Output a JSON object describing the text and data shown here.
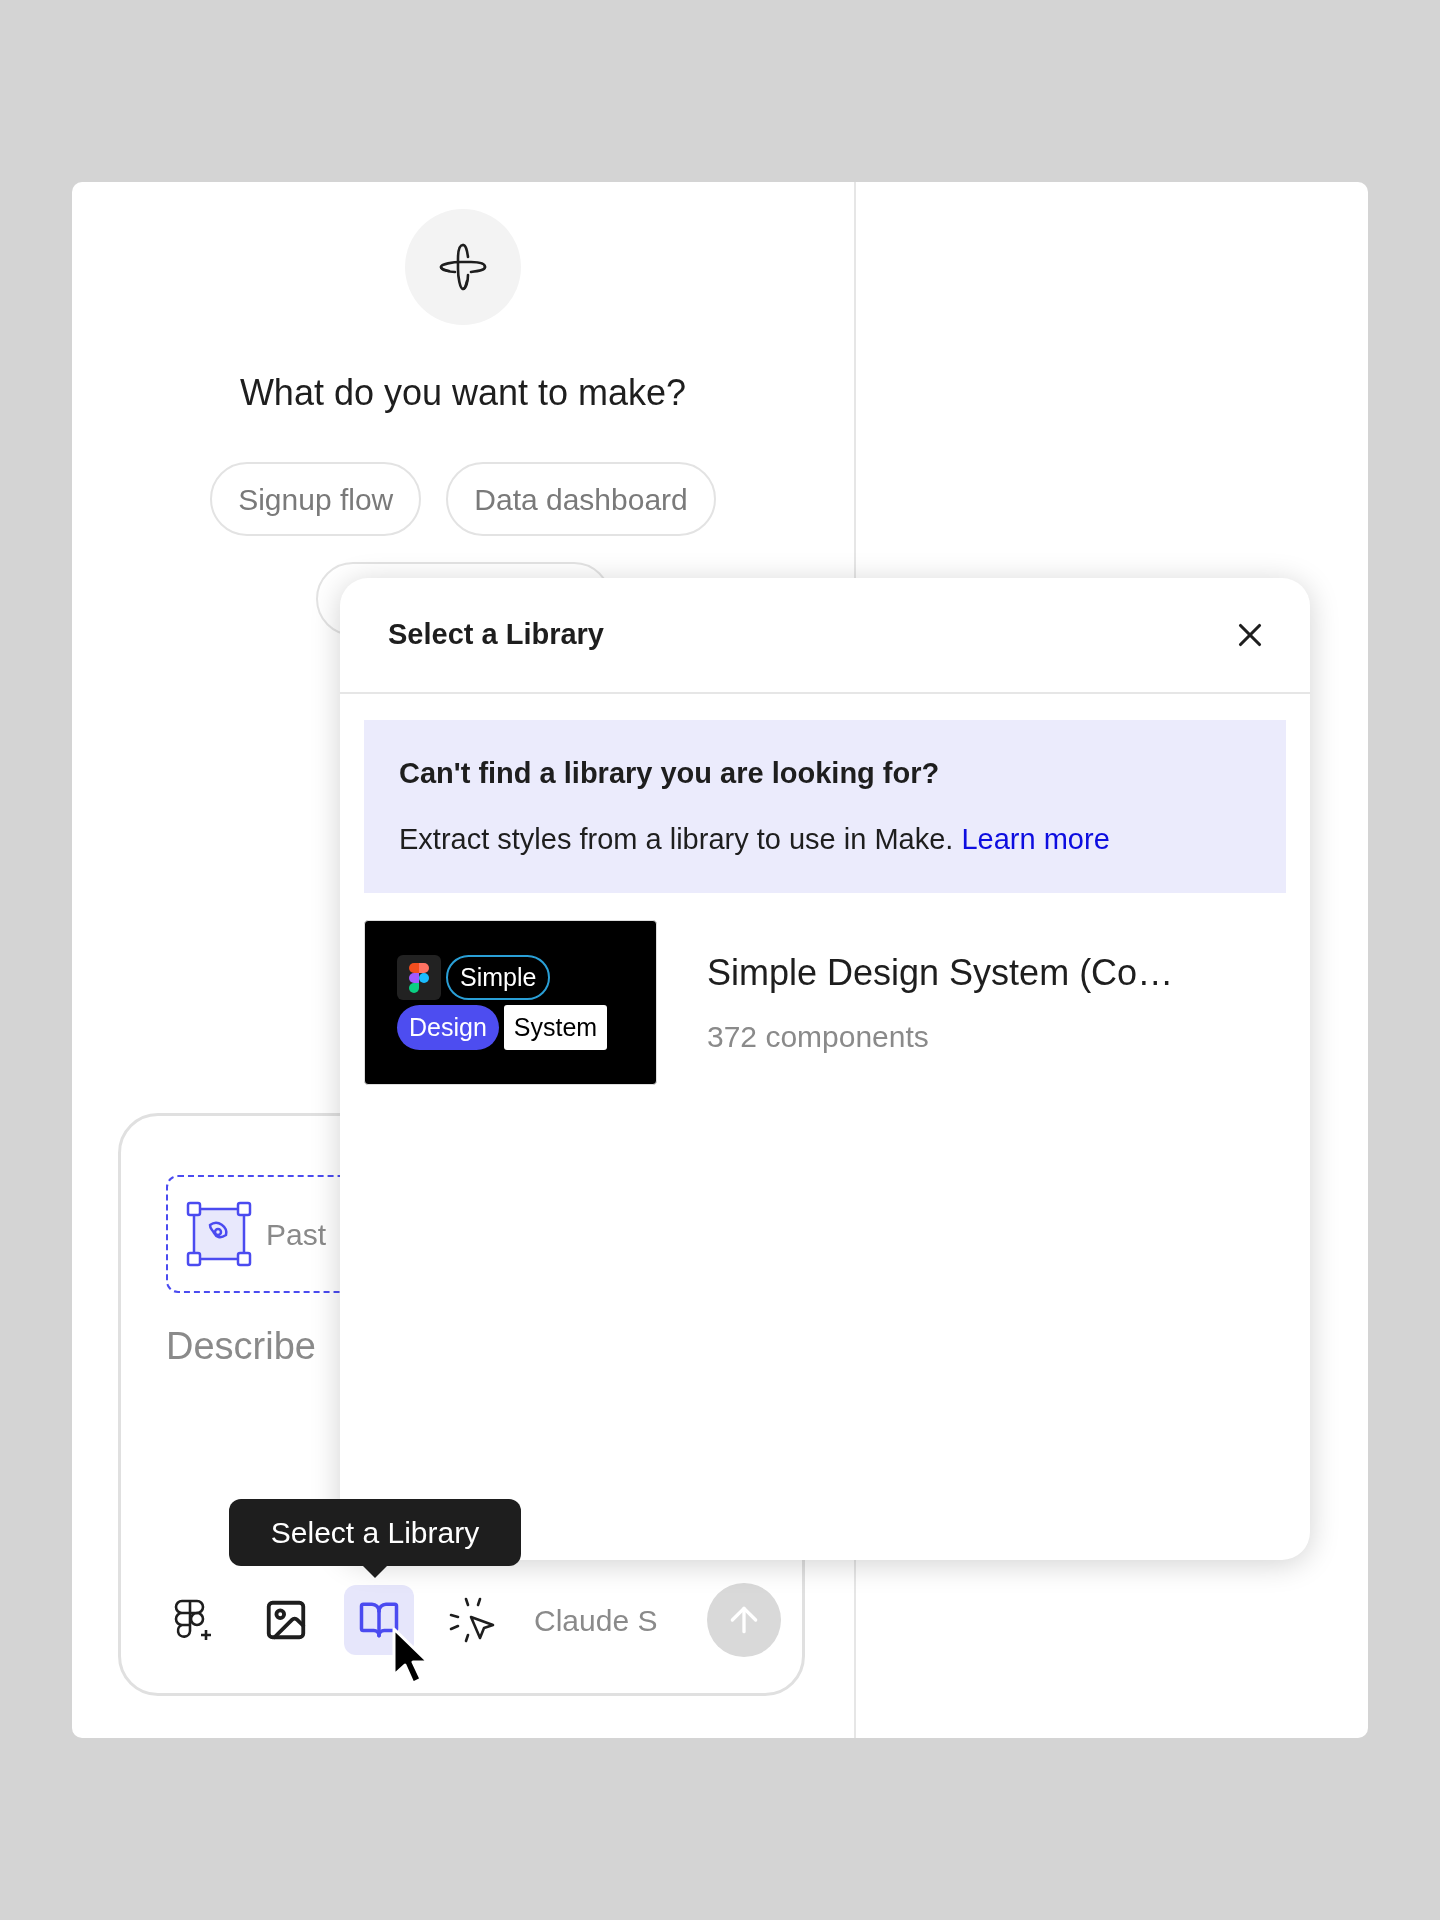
{
  "assistant": {
    "heading": "What do you want to make?"
  },
  "suggestions": [
    {
      "label": "Signup flow"
    },
    {
      "label": "Data dashboard"
    }
  ],
  "composer": {
    "paste_hint": "Past",
    "placeholder": "Describe",
    "model": "Claude S",
    "tools": [
      {
        "kind": "figma",
        "selected": false
      },
      {
        "kind": "image",
        "selected": false
      },
      {
        "kind": "library",
        "selected": true
      },
      {
        "kind": "select",
        "selected": false
      }
    ],
    "tooltip": "Select a Library"
  },
  "dialog": {
    "title": "Select a Library",
    "notice": {
      "title": "Can't find a library you are looking for?",
      "text": "Extract styles from a library to use in Make.",
      "link": "Learn more"
    },
    "libraries": [
      {
        "name": "Simple Design System (Co…",
        "count": "372 components",
        "thumbnail": [
          "Simple",
          "Design",
          "System"
        ]
      }
    ]
  }
}
